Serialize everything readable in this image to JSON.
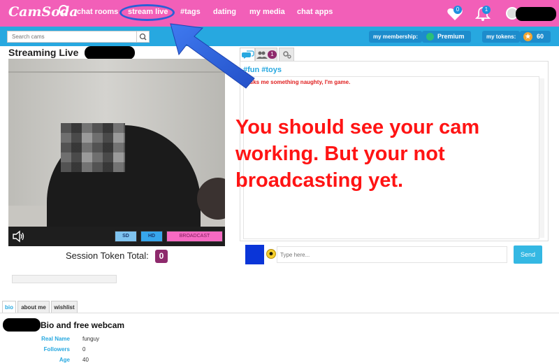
{
  "brand": {
    "logo_text": "CamSoda"
  },
  "nav": {
    "links": [
      "chat rooms",
      "stream live",
      "#tags",
      "dating",
      "my media",
      "chat apps"
    ],
    "favorites_count": "0",
    "notifications_count": "1"
  },
  "subnav": {
    "search_placeholder": "Search cams",
    "membership_label": "my membership:",
    "membership_value": "Premium",
    "tokens_label": "my tokens:",
    "tokens_value": "60"
  },
  "stream": {
    "title": "Streaming Live",
    "buttons": {
      "sd": "SD",
      "hd": "HD",
      "broadcast": "BROADCAST"
    },
    "session_label": "Session Token Total:",
    "session_value": "0"
  },
  "chat": {
    "users_count": "1",
    "topic": "#fun #toys",
    "message": "Asks me something naughty, I'm game.",
    "input_placeholder": "Type here...",
    "send_label": "Send"
  },
  "annotation": {
    "lines": [
      "You should see your cam",
      "working.  But your not",
      "broadcasting yet."
    ]
  },
  "profile": {
    "tabs": [
      "bio",
      "about me",
      "wishlist"
    ],
    "heading": "Bio and free webcam",
    "fields": [
      {
        "label": "Real Name",
        "value": "funguy"
      },
      {
        "label": "Followers",
        "value": "0"
      },
      {
        "label": "Age",
        "value": "40"
      }
    ]
  },
  "colors": {
    "nav_bg": "#f25fb8",
    "subnav_bg": "#27a8e0",
    "annotation": "#ff1414",
    "arrow": "#2b5fd6",
    "badge": "#8e2a6c"
  },
  "icons": [
    "heart-icon",
    "bell-icon",
    "search-icon",
    "chat-icon",
    "users-icon",
    "gear-icon",
    "speaker-icon",
    "smiley-icon",
    "star-icon"
  ]
}
